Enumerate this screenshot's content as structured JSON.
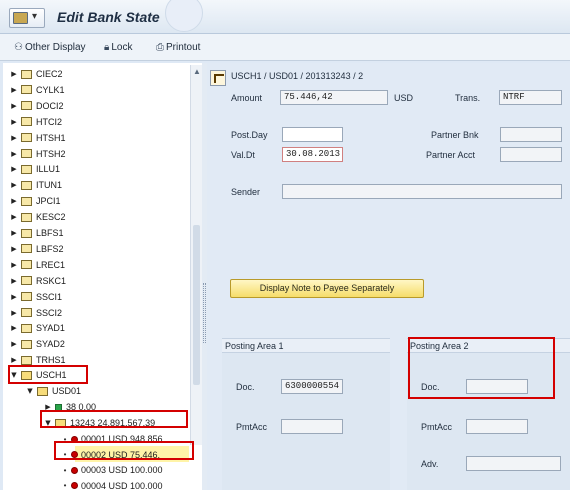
{
  "titlebar": {
    "title": "Edit Bank State"
  },
  "toolbar": {
    "other_display": "Other Display",
    "lock": "Lock",
    "printout": "Printout"
  },
  "tree": {
    "folders": [
      "CIEC2",
      "CYLK1",
      "DOCI2",
      "HTCI2",
      "HTSH1",
      "HTSH2",
      "ILLU1",
      "ITUN1",
      "JPCI1",
      "KESC2",
      "LBFS1",
      "LBFS2",
      "LREC1",
      "RSKC1",
      "SSCI1",
      "SSCI2",
      "SYAD1",
      "SYAD2",
      "TRHS1"
    ],
    "usch1": "USCH1",
    "usd01": "USD01",
    "sub38": "38  0,00",
    "stmt": "13243  24.891.567,39",
    "items": [
      {
        "text": "00001  USD 948.856",
        "status": "red"
      },
      {
        "text": "00002  USD 75.446,",
        "status": "red"
      },
      {
        "text": "00003  USD 100.000",
        "status": "red-star"
      },
      {
        "text": "00004  USD 100.000",
        "status": "red-star"
      }
    ],
    "status_colors": {
      "red": "#c80000",
      "green": "#2aa54a",
      "selected_bg": "#fff4a8"
    }
  },
  "detail": {
    "header": "USCH1 / USD01 / 201313243 / 2",
    "amount_label": "Amount",
    "amount_value": "75.446,42",
    "currency": "USD",
    "trans_label": "Trans.",
    "trans_value": "NTRF",
    "postday_label": "Post.Day",
    "postday_value": "",
    "valdt_label": "Val.Dt",
    "valdt_value": "30.08.2013",
    "partner_bnk_label": "Partner Bnk",
    "partner_acct_label": "Partner Acct",
    "sender_label": "Sender",
    "note_button": "Display Note to Payee Separately",
    "area1": {
      "title": "Posting Area 1",
      "doc_label": "Doc.",
      "doc_value": "6300000554",
      "pmt_label": "PmtAcc"
    },
    "area2": {
      "title": "Posting Area 2",
      "doc_label": "Doc.",
      "pmt_label": "PmtAcc",
      "adv_label": "Adv."
    }
  },
  "colors": {
    "highlight_box": "#d40000",
    "button": "#f6dd6a"
  }
}
